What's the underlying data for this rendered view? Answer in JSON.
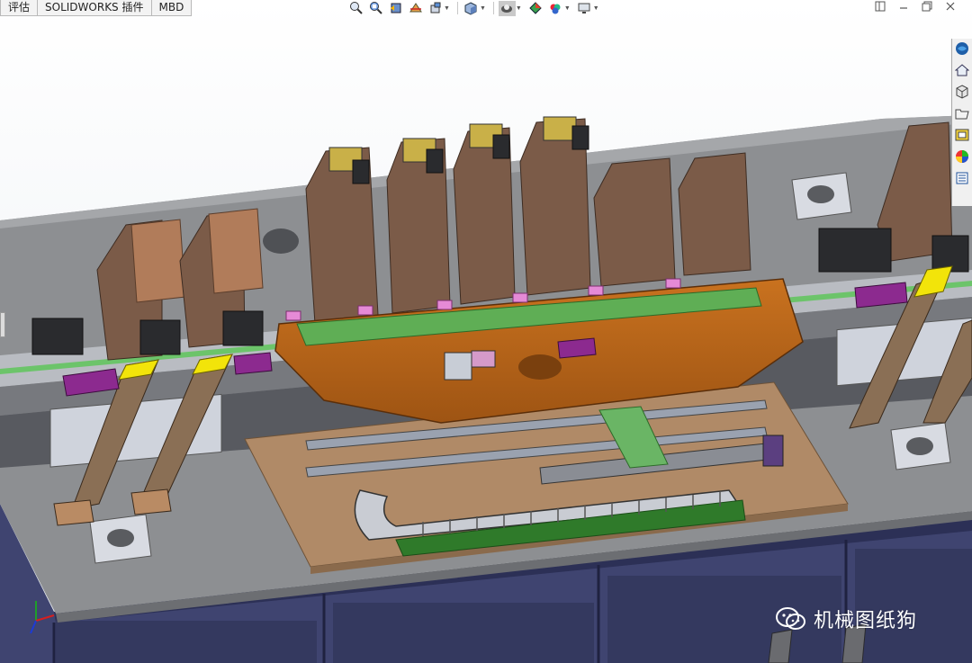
{
  "command_manager": {
    "tabs": [
      {
        "label": "评估"
      },
      {
        "label": "SOLIDWORKS 插件"
      },
      {
        "label": "MBD"
      }
    ]
  },
  "view_toolbar": {
    "buttons": [
      {
        "icon": "zoom-to-fit-icon"
      },
      {
        "icon": "zoom-to-area-icon"
      },
      {
        "icon": "previous-view-icon"
      },
      {
        "icon": "section-view-icon"
      },
      {
        "icon": "dynamic-annotation-icon"
      },
      {
        "icon": "view-orientation-icon"
      },
      {
        "icon": "display-style-icon"
      },
      {
        "icon": "hide-show-items-icon"
      },
      {
        "icon": "edit-appearance-icon"
      },
      {
        "icon": "apply-scene-icon"
      },
      {
        "icon": "view-settings-icon"
      }
    ]
  },
  "window_controls": {
    "buttons": [
      {
        "icon": "tile-left-icon"
      },
      {
        "icon": "minimize-icon"
      },
      {
        "icon": "restore-icon"
      },
      {
        "icon": "close-icon"
      }
    ]
  },
  "task_pane": {
    "tabs": [
      {
        "icon": "solidworks-resources-icon"
      },
      {
        "icon": "home-icon"
      },
      {
        "icon": "design-library-icon"
      },
      {
        "icon": "file-explorer-icon"
      },
      {
        "icon": "view-palette-icon"
      },
      {
        "icon": "appearances-scenes-icon"
      },
      {
        "icon": "custom-properties-icon"
      }
    ]
  },
  "watermark": {
    "text": "机械图纸狗",
    "icon": "wechat-icon"
  },
  "colors": {
    "frame_blue": "#4a4f78",
    "plate_gray": "#8e9092",
    "fixture_orange": "#b8661d",
    "guide_green": "#5fae55",
    "pad_yellow": "#f2e40a",
    "wood_tan": "#b08a67",
    "clamp_purple": "#8c2a8f"
  }
}
